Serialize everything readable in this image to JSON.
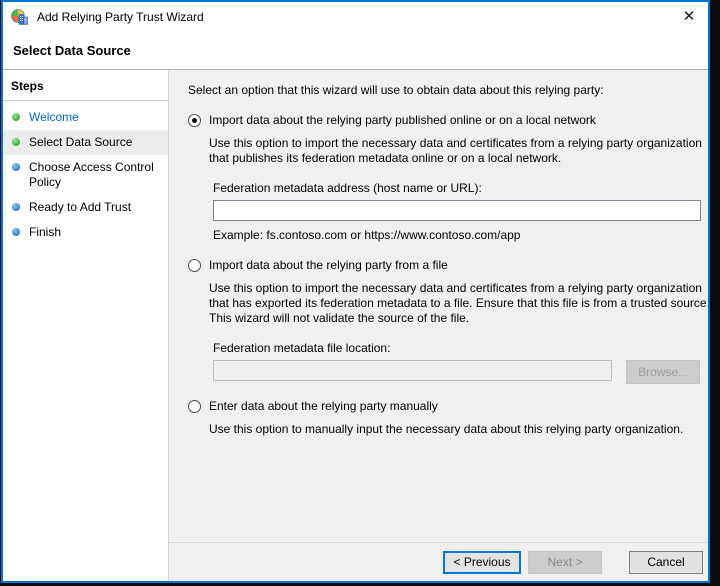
{
  "window": {
    "title": "Add Relying Party Trust Wizard",
    "close_glyph": "✕"
  },
  "header": {
    "title": "Select Data Source"
  },
  "sidebar": {
    "title": "Steps",
    "items": [
      {
        "label": "Welcome",
        "status": "visited"
      },
      {
        "label": "Select Data Source",
        "status": "current"
      },
      {
        "label": "Choose Access Control Policy",
        "status": "upcoming"
      },
      {
        "label": "Ready to Add Trust",
        "status": "upcoming"
      },
      {
        "label": "Finish",
        "status": "upcoming"
      }
    ]
  },
  "main": {
    "intro": "Select an option that this wizard will use to obtain data about this relying party:",
    "options": [
      {
        "label": "Import data about the relying party published online or on a local network",
        "selected": true,
        "description": "Use this option to import the necessary data and certificates from a relying party organization that publishes its federation metadata online or on a local network.",
        "field_label": "Federation metadata address (host name or URL):",
        "field_value": "",
        "example": "Example: fs.contoso.com or https://www.contoso.com/app"
      },
      {
        "label": "Import data about the relying party from a file",
        "selected": false,
        "description": "Use this option to import the necessary data and certificates from a relying party organization that has exported its federation metadata to a file. Ensure that this file is from a trusted source.  This wizard will not validate the source of the file.",
        "field_label": "Federation metadata file location:",
        "field_value": "",
        "browse_label": "Browse..."
      },
      {
        "label": "Enter data about the relying party manually",
        "selected": false,
        "description": "Use this option to manually input the necessary data about this relying party organization."
      }
    ]
  },
  "footer": {
    "previous_label": "< Previous",
    "next_label": "Next >",
    "cancel_label": "Cancel"
  },
  "colors": {
    "accent": "#0078d7",
    "link": "#0066cc",
    "step_done_bullet": "#35b135",
    "step_todo_bullet": "#2f7fd0",
    "content_bg": "#f0f0f0"
  }
}
